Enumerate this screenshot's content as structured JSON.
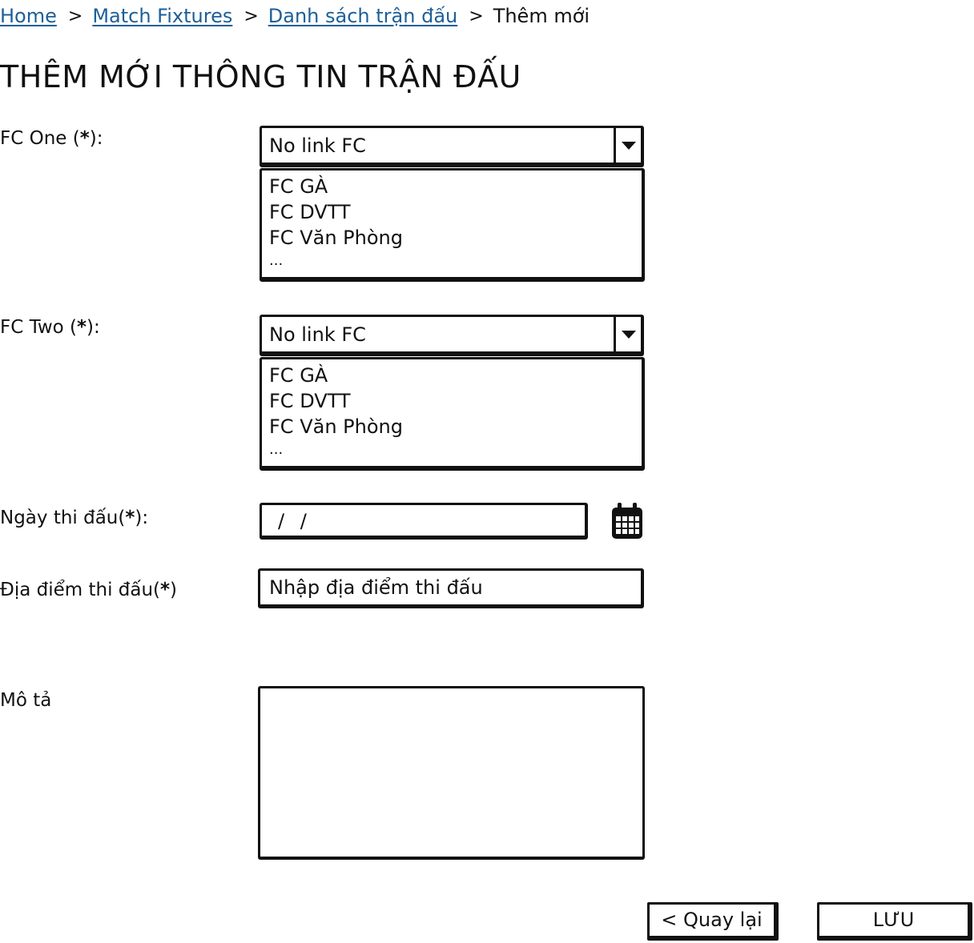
{
  "breadcrumb": {
    "items": [
      {
        "label": "Home"
      },
      {
        "label": "Match Fixtures"
      },
      {
        "label": "Danh sách trận đấu"
      }
    ],
    "separator": ">",
    "current": "Thêm mới"
  },
  "page_title": "THÊM MỚI THÔNG TIN TRẬN ĐẤU",
  "form": {
    "fc_one": {
      "label": "FC One (",
      "required_mark": "*",
      "label_suffix": "):",
      "selected": "No link FC",
      "options": [
        "FC GÀ",
        "FC DVTT",
        "FC Văn Phòng",
        "..."
      ]
    },
    "fc_two": {
      "label": "FC Two (",
      "required_mark": "*",
      "label_suffix": "):",
      "selected": "No link FC",
      "options": [
        "FC GÀ",
        "FC DVTT",
        "FC Văn Phòng",
        "..."
      ]
    },
    "match_date": {
      "label": "Ngày thi đấu(",
      "required_mark": "*",
      "label_suffix": "):",
      "value": "/ /",
      "icon": "calendar-icon"
    },
    "location": {
      "label": "Địa điểm thi đấu(",
      "required_mark": "*",
      "label_suffix": ")",
      "placeholder": "Nhập địa điểm thi đấu"
    },
    "description": {
      "label": "Mô tả",
      "value": ""
    }
  },
  "buttons": {
    "back": "< Quay lại",
    "save": "LƯU"
  },
  "colors": {
    "link": "#1d5f99",
    "ink": "#111111"
  }
}
